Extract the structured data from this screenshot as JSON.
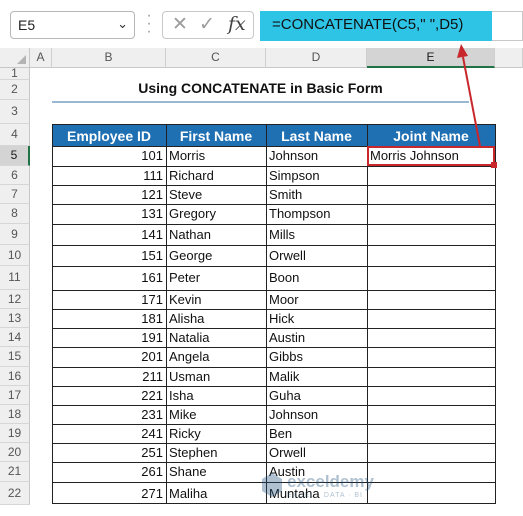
{
  "namebox": {
    "value": "E5"
  },
  "formula_bar": {
    "formula": "=CONCATENATE(C5,\" \",D5)",
    "fx_label": "fx"
  },
  "columns": [
    "A",
    "B",
    "C",
    "D",
    "E"
  ],
  "rows": [
    "1",
    "2",
    "3",
    "4",
    "5",
    "6",
    "7",
    "8",
    "9",
    "10",
    "11",
    "12",
    "13",
    "14",
    "15",
    "16",
    "17",
    "18",
    "19",
    "20",
    "21",
    "22"
  ],
  "title": "Using CONCATENATE in Basic Form",
  "table": {
    "headers": [
      "Employee ID",
      "First Name",
      "Last Name",
      "Joint Name"
    ],
    "rows": [
      [
        "101",
        "Morris",
        "Johnson",
        "Morris Johnson"
      ],
      [
        "111",
        "Richard",
        "Simpson",
        ""
      ],
      [
        "121",
        "Steve",
        "Smith",
        ""
      ],
      [
        "131",
        "Gregory",
        "Thompson",
        ""
      ],
      [
        "141",
        "Nathan",
        "Mills",
        ""
      ],
      [
        "151",
        "George",
        "Orwell",
        ""
      ],
      [
        "161",
        "Peter",
        "Boon",
        ""
      ],
      [
        "171",
        "Kevin",
        "Moor",
        ""
      ],
      [
        "181",
        "Alisha",
        "Hick",
        ""
      ],
      [
        "191",
        "Natalia",
        "Austin",
        ""
      ],
      [
        "201",
        "Angela",
        "Gibbs",
        ""
      ],
      [
        "211",
        "Usman",
        "Malik",
        ""
      ],
      [
        "221",
        "Isha",
        "Guha",
        ""
      ],
      [
        "231",
        "Mike",
        "Johnson",
        ""
      ],
      [
        "241",
        "Ricky",
        "Ben",
        ""
      ],
      [
        "251",
        "Stephen",
        "Orwell",
        ""
      ],
      [
        "261",
        "Shane",
        "Austin",
        ""
      ],
      [
        "271",
        "Maliha",
        "Muntaha",
        ""
      ]
    ]
  },
  "watermark": {
    "name": "exceldemy",
    "tagline": "EXCEL · DATA · BI"
  },
  "colors": {
    "header_fill": "#1f6fb3",
    "formula_highlight": "#2ec4e6",
    "selection": "#c8282c"
  }
}
